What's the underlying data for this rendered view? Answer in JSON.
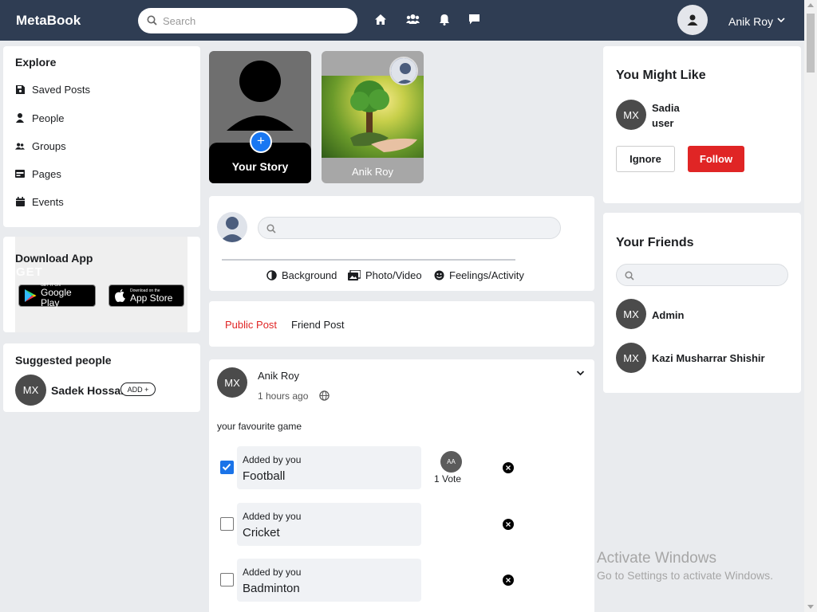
{
  "header": {
    "brand": "MetaBook",
    "search_placeholder": "Search",
    "user_name": "Anik Roy"
  },
  "explore": {
    "title": "Explore",
    "items": [
      {
        "label": "Saved Posts",
        "icon": "save-icon"
      },
      {
        "label": "People",
        "icon": "person-icon"
      },
      {
        "label": "Groups",
        "icon": "group-icon"
      },
      {
        "label": "Pages",
        "icon": "page-icon"
      },
      {
        "label": "Events",
        "icon": "calendar-icon"
      }
    ]
  },
  "download": {
    "title": "Download App",
    "watermark": "GET",
    "google": {
      "small": "GET IT ON",
      "big": "Google Play"
    },
    "apple": {
      "small": "Download on the",
      "big": "App Store"
    }
  },
  "suggested": {
    "title": "Suggested people",
    "people": [
      {
        "initials": "MX",
        "name": "Sadek Hossain",
        "action": "ADD +"
      }
    ]
  },
  "stories": [
    {
      "label": "Your Story",
      "plus": "+"
    },
    {
      "label": "Anik Roy"
    }
  ],
  "composer": {
    "actions": [
      "Background",
      "Photo/Video",
      "Feelings/Activity"
    ]
  },
  "tabs": [
    "Public Post",
    "Friend Post"
  ],
  "post": {
    "author_initials": "MX",
    "author": "Anik Roy",
    "time": "1 hours ago",
    "text": "your favourite game",
    "options": [
      {
        "added": "Added by you",
        "name": "Football",
        "checked": true
      },
      {
        "added": "Added by you",
        "name": "Cricket",
        "checked": false
      },
      {
        "added": "Added by you",
        "name": "Badminton",
        "checked": false
      }
    ],
    "voter_initials": "AA",
    "vote_count": "1 Vote"
  },
  "might_like": {
    "title": "You Might Like",
    "initials": "MX",
    "name": "Sadia",
    "role": "user",
    "ignore_label": "Ignore",
    "follow_label": "Follow"
  },
  "friends": {
    "title": "Your Friends",
    "list": [
      {
        "initials": "MX",
        "name": "Admin"
      },
      {
        "initials": "MX",
        "name": "Kazi Musharrar Shishir"
      }
    ]
  },
  "activation": {
    "line1": "Activate Windows",
    "line2": "Go to Settings to activate Windows."
  },
  "colors": {
    "topbar": "#2f3d53",
    "accent_red": "#e02525",
    "check_blue": "#1a73e8",
    "story_plus": "#1877f2"
  }
}
